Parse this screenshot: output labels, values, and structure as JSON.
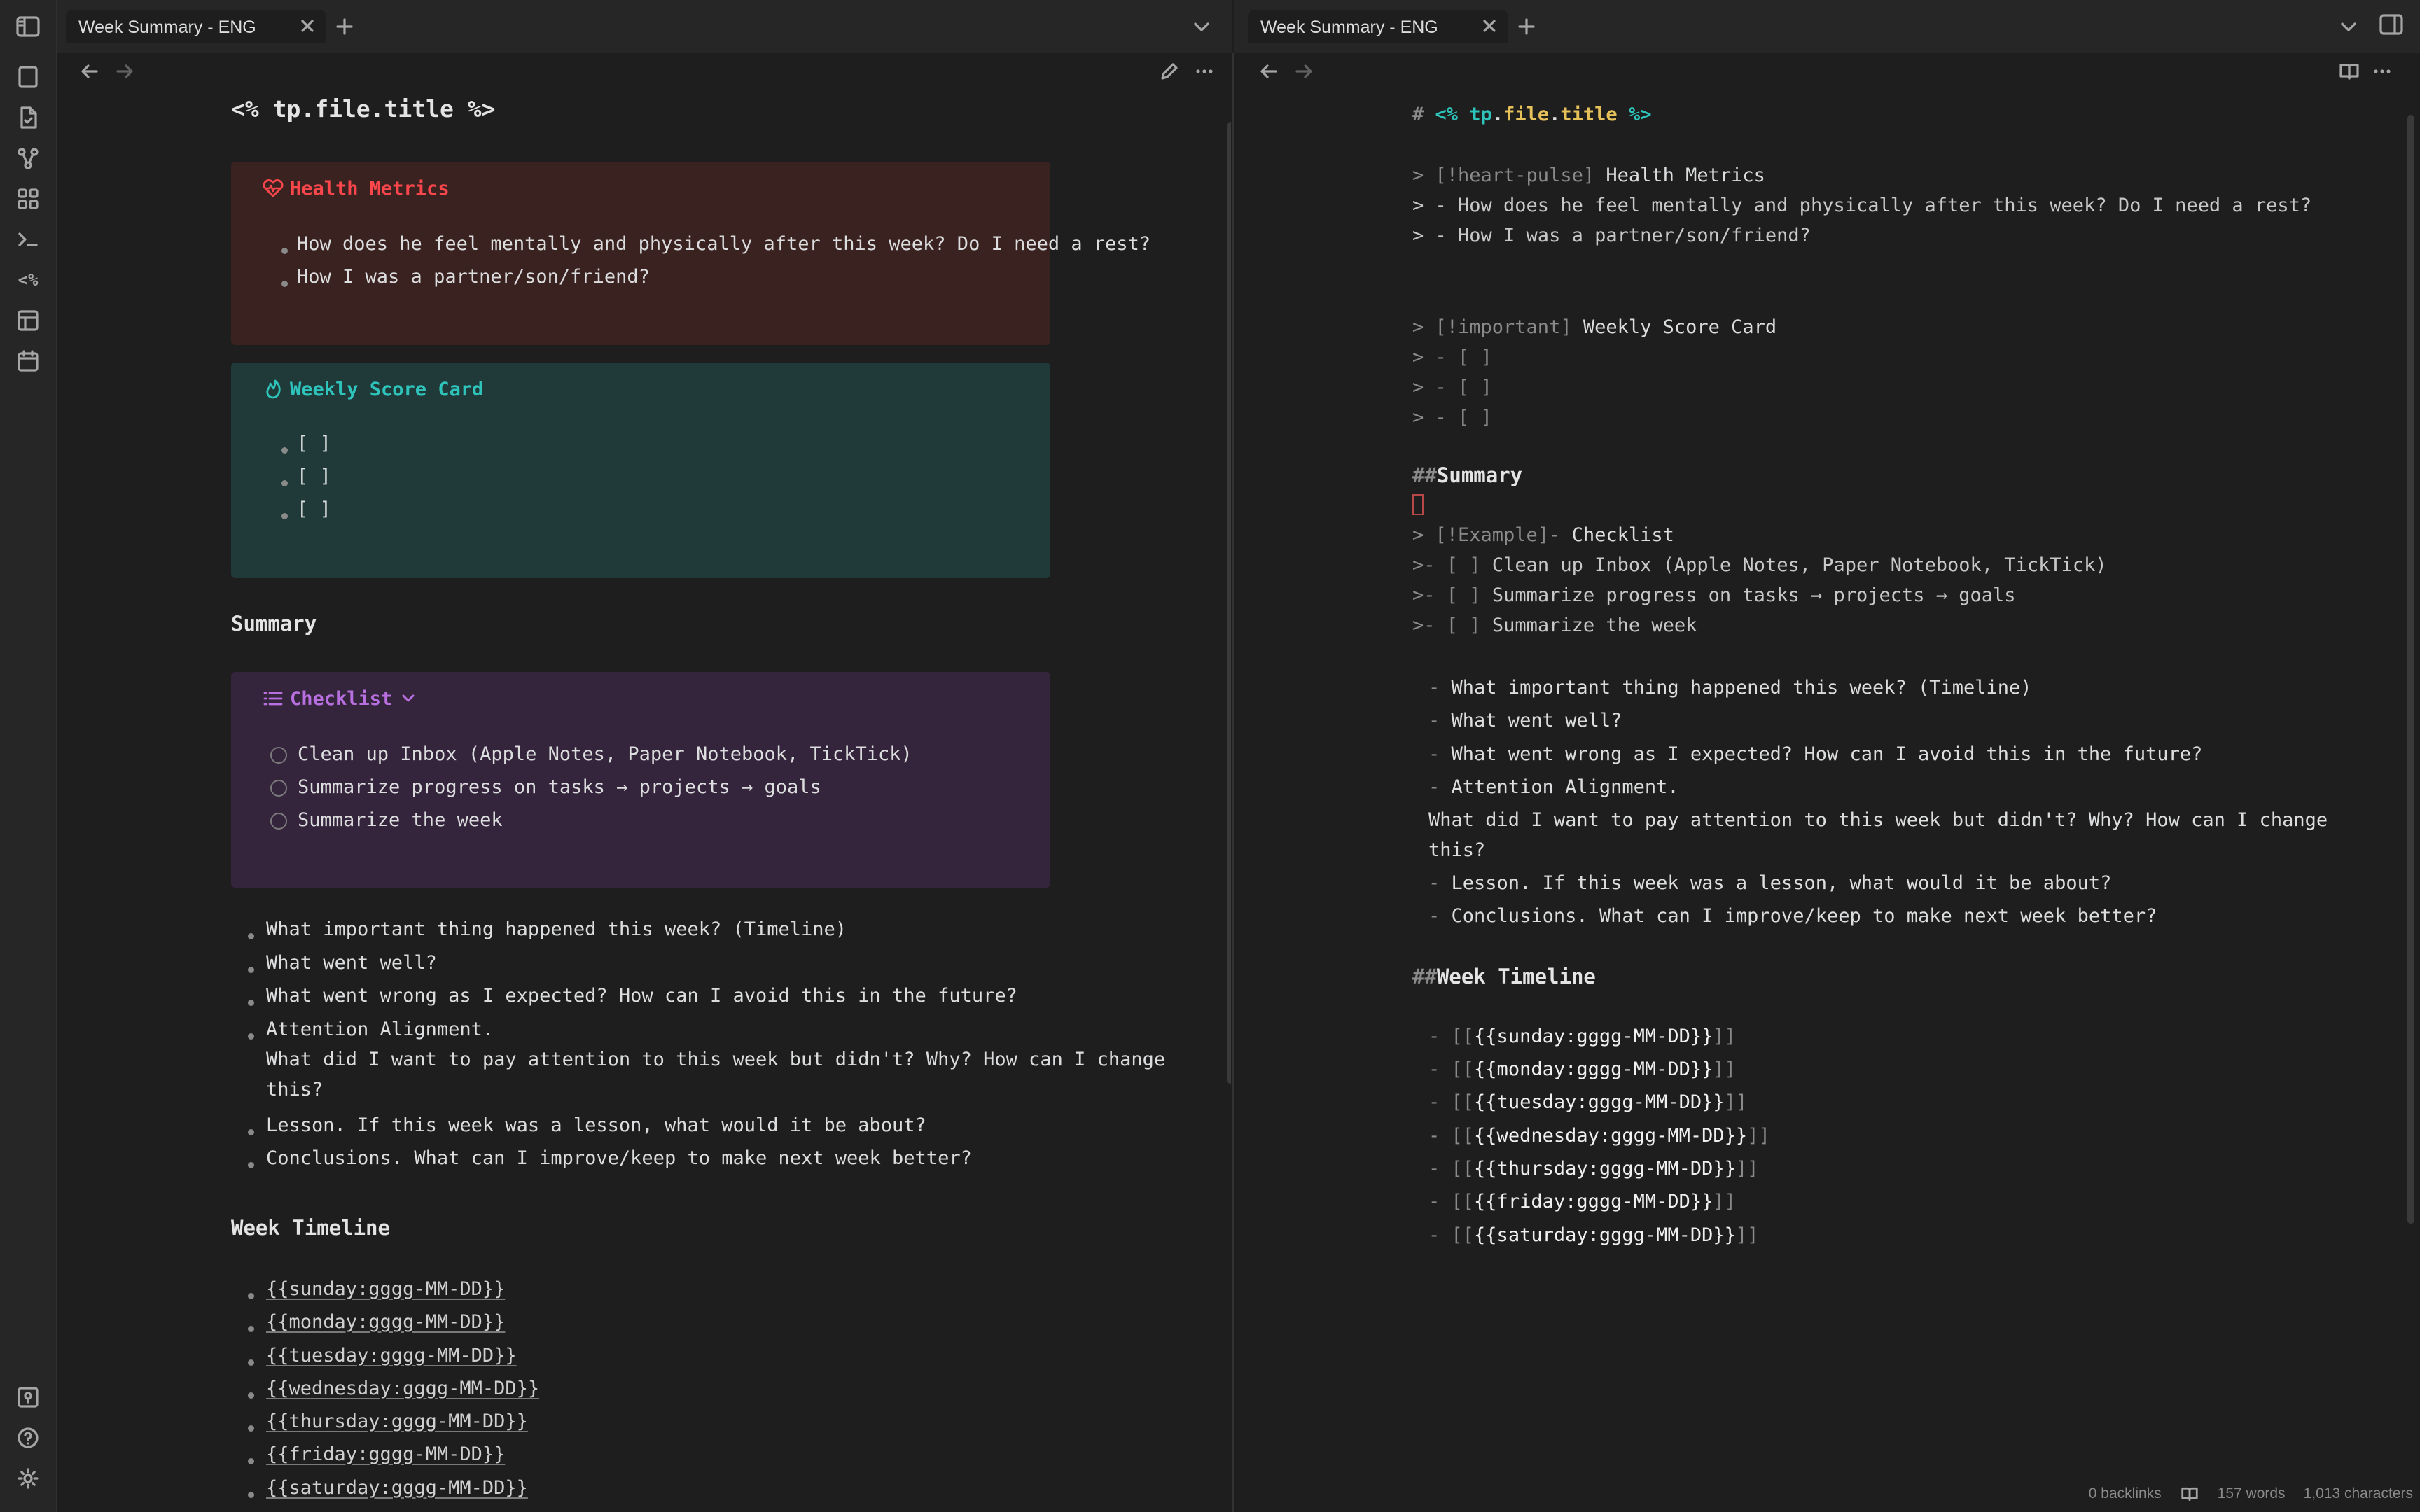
{
  "colors": {
    "accent_red": "#fb464c",
    "accent_teal": "#2ec4bb",
    "accent_purple": "#b86fe0",
    "template_yellow": "#e6c15a",
    "background": "#1e1e1e"
  },
  "ribbon": {
    "top_icons": [
      "sidebar-toggle-icon",
      "file-icon",
      "files-icon",
      "graph-icon",
      "canvas-grid-icon",
      "terminal-icon",
      "templater-icon",
      "layout-icon",
      "calendar-icon"
    ],
    "templater_glyph": "<%",
    "bottom_icons": [
      "vault-icon",
      "help-icon",
      "settings-icon"
    ]
  },
  "left_pane": {
    "tab_title": "Week Summary - ENG",
    "file_title": "<% tp.file.title %>",
    "health_callout": {
      "title": "Health Metrics",
      "items": [
        "How does he feel mentally and physically after this week? Do I need a rest?",
        "How I was a partner/son/friend?"
      ]
    },
    "score_callout": {
      "title": "Weekly Score Card",
      "items": [
        "[ ]",
        "[ ]",
        "[ ]"
      ]
    },
    "summary_heading": "Summary",
    "checklist_callout": {
      "title": "Checklist",
      "items": [
        "Clean up Inbox (Apple Notes, Paper Notebook, TickTick)",
        "Summarize progress on tasks → projects → goals",
        "Summarize the week"
      ]
    },
    "summary_items": [
      "What important thing happened this week? (Timeline)",
      "What went well?",
      "What went wrong as I expected? How can I avoid this in the future?",
      "Attention Alignment.",
      "What did I want to pay attention to this week but didn't? Why? How can I change",
      "this?",
      "Lesson. If this week was a lesson, what would it be about?",
      "Conclusions. What can I improve/keep to make next week better?"
    ],
    "timeline_heading": "Week Timeline",
    "timeline_items": [
      "{{sunday:gggg-MM-DD}}",
      "{{monday:gggg-MM-DD}}",
      "{{tuesday:gggg-MM-DD}}",
      "{{wednesday:gggg-MM-DD}}",
      "{{thursday:gggg-MM-DD}}",
      "{{friday:gggg-MM-DD}}",
      "{{saturday:gggg-MM-DD}}"
    ]
  },
  "right_pane": {
    "tab_title": "Week Summary - ENG",
    "title_hash": "#",
    "title_parts": [
      "<%",
      "tp",
      ".",
      "file",
      ".",
      "title",
      "%>"
    ],
    "health": {
      "prefix": "> [!heart-pulse]",
      "title": "Health Metrics",
      "lines": [
        "> - How does he feel mentally and physically after this week? Do I need a rest?",
        "> - How I was a partner/son/friend?"
      ]
    },
    "score": {
      "prefix": "> [!important]",
      "title": "Weekly Score Card",
      "lines": [
        "> - [ ]",
        "> - [ ]",
        "> - [ ]"
      ]
    },
    "summary_hash": "##",
    "summary_heading": "Summary",
    "checklist": {
      "prefix": "> [!Example]-",
      "title": "Checklist",
      "line_prefix": ">- [ ]",
      "lines": [
        "Clean up Inbox (Apple Notes, Paper Notebook, TickTick)",
        "Summarize progress on tasks → projects → goals",
        "Summarize the week"
      ]
    },
    "dash": "-",
    "summary_items": [
      "What important thing happened this week? (Timeline)",
      "What went well?",
      "What went wrong as I expected? How can I avoid this in the future?",
      "Attention Alignment."
    ],
    "continuation": [
      "What did I want to pay attention to this week but didn't? Why? How can I change",
      "this?"
    ],
    "summary_items_2": [
      "Lesson. If this week was a lesson, what would it be about?",
      "Conclusions. What can I improve/keep to make next week better?"
    ],
    "timeline_hash": "##",
    "timeline_heading": "Week Timeline",
    "link_open": "[[",
    "link_close": "]]",
    "timeline_items": [
      "{{sunday:gggg-MM-DD}}",
      "{{monday:gggg-MM-DD}}",
      "{{tuesday:gggg-MM-DD}}",
      "{{wednesday:gggg-MM-DD}}",
      "{{thursday:gggg-MM-DD}}",
      "{{friday:gggg-MM-DD}}",
      "{{saturday:gggg-MM-DD}}"
    ]
  },
  "status_bar": {
    "backlinks": "0 backlinks",
    "words": "157 words",
    "characters": "1,013 characters"
  }
}
